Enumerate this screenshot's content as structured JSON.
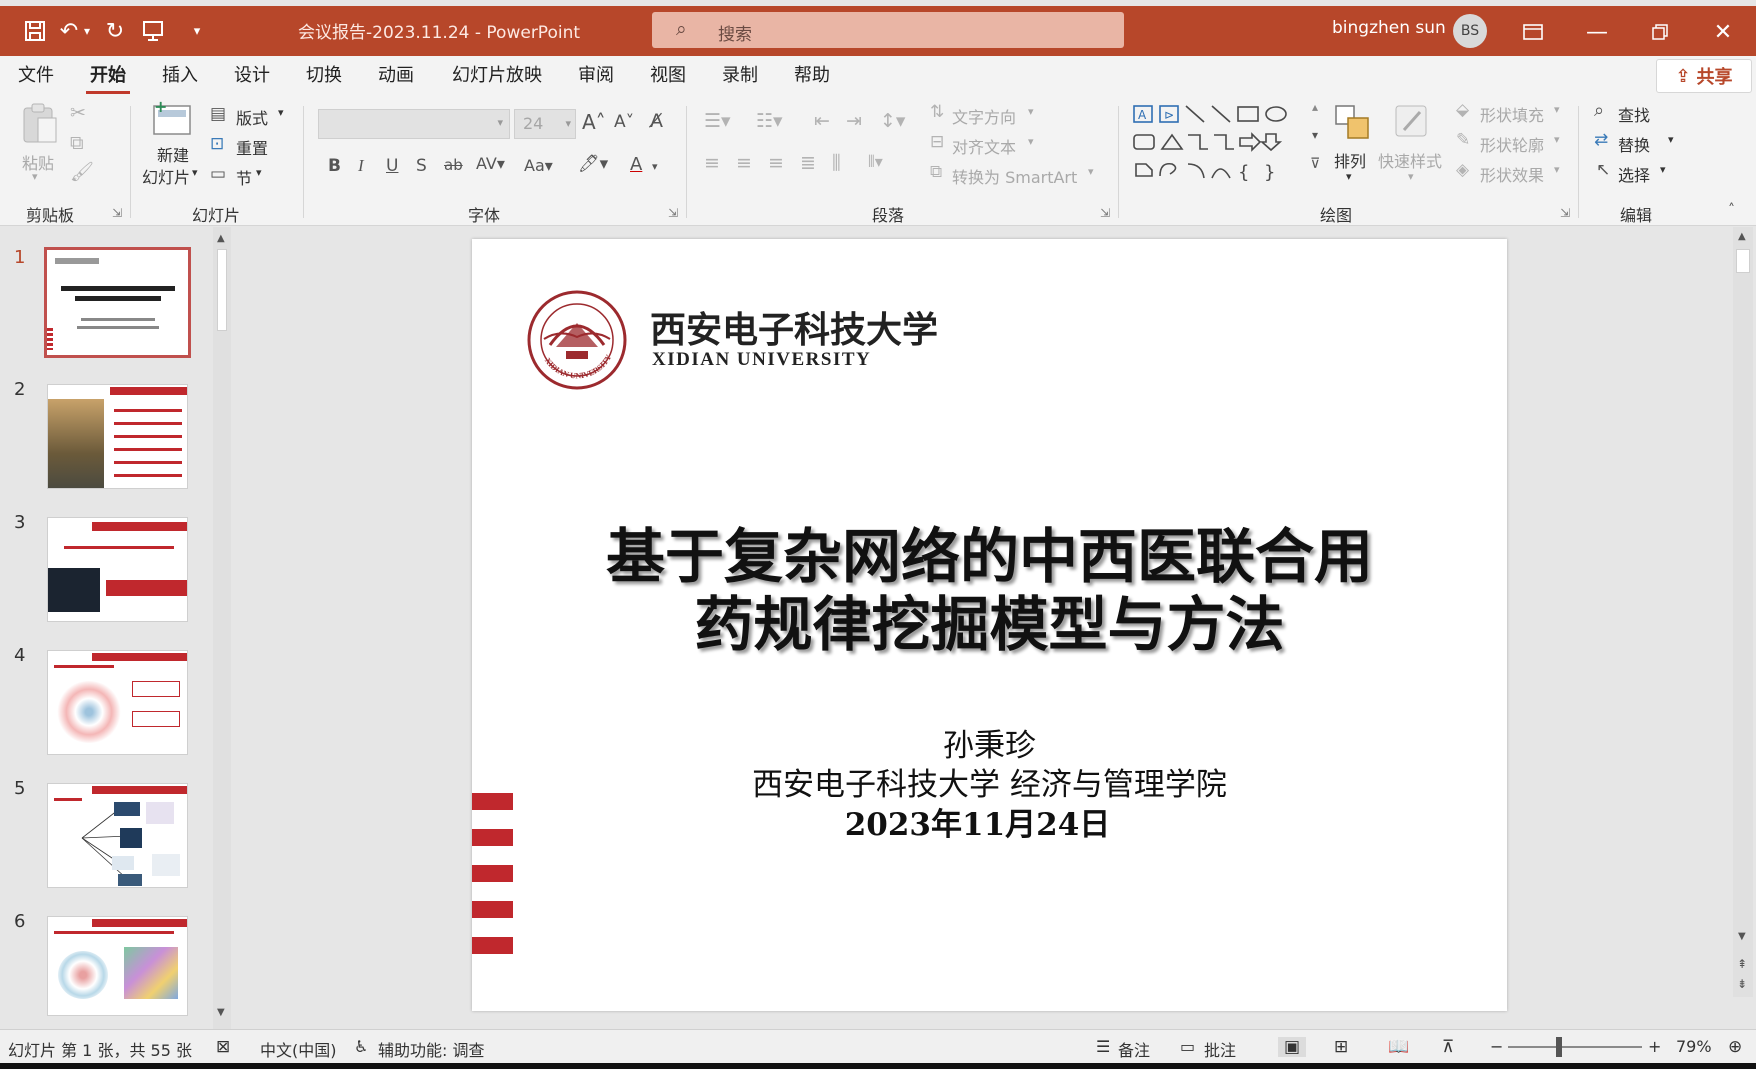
{
  "window": {
    "document_title": "会议报告-2023.11.24  -  PowerPoint",
    "search_placeholder": "搜索",
    "user_name": "bingzhen sun",
    "user_initials": "BS"
  },
  "menu": {
    "tabs": [
      "文件",
      "开始",
      "插入",
      "设计",
      "切换",
      "动画",
      "幻灯片放映",
      "审阅",
      "视图",
      "录制",
      "帮助"
    ],
    "active_tab": "开始",
    "share_label": "共享"
  },
  "ribbon": {
    "clipboard": {
      "paste": "粘贴",
      "group": "剪贴板"
    },
    "slides": {
      "new_slide_line1": "新建",
      "new_slide_line2": "幻灯片",
      "layout": "版式",
      "reset": "重置",
      "section": "节",
      "group": "幻灯片"
    },
    "font": {
      "size_value": "24",
      "group": "字体"
    },
    "paragraph": {
      "text_direction": "文字方向",
      "align_text": "对齐文本",
      "convert_smartart": "转换为 SmartArt",
      "group": "段落"
    },
    "drawing": {
      "arrange": "排列",
      "quick_styles": "快速样式",
      "shape_fill": "形状填充",
      "shape_outline": "形状轮廓",
      "shape_effects": "形状效果",
      "group": "绘图"
    },
    "editing": {
      "find": "查找",
      "replace": "替换",
      "select": "选择",
      "group": "编辑"
    }
  },
  "thumbnails": [
    {
      "number": "1",
      "selected": true
    },
    {
      "number": "2",
      "selected": false
    },
    {
      "number": "3",
      "selected": false
    },
    {
      "number": "4",
      "selected": false
    },
    {
      "number": "5",
      "selected": false
    },
    {
      "number": "6",
      "selected": false
    }
  ],
  "slide": {
    "university_cn": "西安电子科技大学",
    "university_en": "XIDIAN UNIVERSITY",
    "seal_text": "XIDIAN UNIVERSITY",
    "title_line1": "基于复杂网络的中西医联合用",
    "title_line2": "药规律挖掘模型与方法",
    "author": "孙秉珍",
    "affiliation": "西安电子科技大学   经济与管理学院",
    "date": "2023年11月24日"
  },
  "statusbar": {
    "slide_info": "幻灯片 第 1 张，共 55 张",
    "language": "中文(中国)",
    "accessibility": "辅助功能: 调查",
    "notes": "备注",
    "comments": "批注",
    "zoom": "79%"
  },
  "colors": {
    "titlebar": "#b7472a",
    "accent_red": "#c0282d",
    "ribbon_bg": "#f3f3f3"
  }
}
